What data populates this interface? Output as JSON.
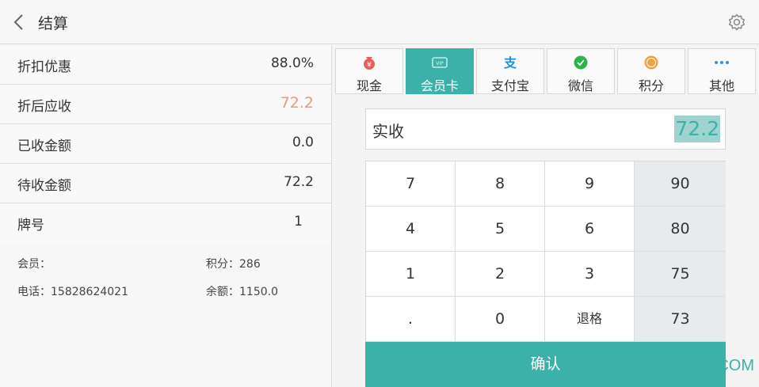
{
  "header": {
    "title": "结算"
  },
  "summary": [
    {
      "label": "折扣优惠",
      "value": "88.0%"
    },
    {
      "label": "折后应收",
      "value": "72.2"
    },
    {
      "label": "已收金额",
      "value": "0.0"
    },
    {
      "label": "待收金额",
      "value": "72.2"
    },
    {
      "label": "牌号",
      "value": "1"
    }
  ],
  "member": {
    "member_label": "会员：",
    "points_label": "积分：286",
    "phone_label": "电话：15828624021",
    "balance_label": "余额：1150.0"
  },
  "payment_tabs": [
    {
      "label": "现金",
      "icon": "cash-bag-icon"
    },
    {
      "label": "会员卡",
      "icon": "vip-card-icon",
      "active": true
    },
    {
      "label": "支付宝",
      "icon": "alipay-icon"
    },
    {
      "label": "微信",
      "icon": "wechat-icon"
    },
    {
      "label": "积分",
      "icon": "points-icon"
    },
    {
      "label": "其他",
      "icon": "more-dots-icon"
    }
  ],
  "amount": {
    "label": "实收",
    "value": "72.2"
  },
  "keypad": {
    "keys": [
      "7",
      "8",
      "9",
      "4",
      "5",
      "6",
      "1",
      "2",
      "3",
      ".",
      "0",
      "退格"
    ],
    "quick": [
      "90",
      "80",
      "75",
      "73"
    ],
    "confirm": "确认"
  },
  "watermark": "ITMOP.COM",
  "colors": {
    "accent": "#3bb1aa",
    "highlight": "#e89a7a"
  }
}
